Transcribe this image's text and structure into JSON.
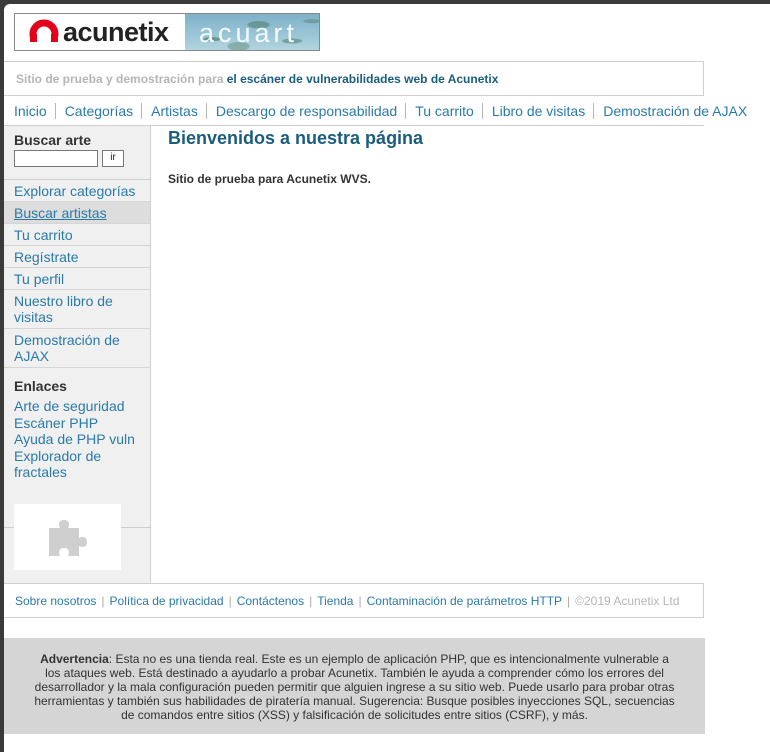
{
  "logo": {
    "brand": "acunetix",
    "product": "acuart"
  },
  "tagline": {
    "muted": "Sitio de prueba y demostración para",
    "strong": "el escáner de vulnerabilidades web de Acunetix"
  },
  "topnav": [
    "Inicio",
    "Categorías",
    "Artistas",
    "Descargo de responsabilidad",
    "Tu carrito",
    "Libro de visitas",
    "Demostración de AJAX"
  ],
  "sidebar": {
    "search_title": "Buscar arte",
    "search_value": "",
    "search_button": "ir",
    "items": [
      "Explorar categorías",
      "Buscar artistas",
      "Tu carrito",
      "Regístrate",
      "Tu perfil",
      "Nuestro libro de visitas",
      "Demostración de AJAX"
    ],
    "links_title": "Enlaces",
    "links": [
      "Arte de seguridad",
      "Escáner PHP",
      "Ayuda de PHP vuln",
      "Explorador de fractales"
    ],
    "plugin_icon": "puzzle-icon"
  },
  "main": {
    "title": "Bienvenidos a nuestra página",
    "text": "Sitio de prueba para Acunetix WVS."
  },
  "footer": {
    "links": [
      "Sobre nosotros",
      "Política de privacidad",
      "Contáctenos",
      "Tienda",
      "Contaminación de parámetros HTTP"
    ],
    "copyright": "©2019 Acunetix Ltd"
  },
  "warning": {
    "label": "Advertencia",
    "text": ": Esta no es una tienda real. Este es un ejemplo de aplicación PHP, que es intencionalmente vulnerable a los ataques web. Está destinado a ayudarlo a probar Acunetix. También le ayuda a comprender cómo los errores del desarrollador y la mala configuración pueden permitir que alguien ingrese a su sitio web. Puede usarlo para probar otras herramientas y también sus habilidades de piratería manual. Sugerencia: Busque posibles inyecciones SQL, secuencias de comandos entre sitios (XSS) y falsificación de solicitudes entre sitios (CSRF), y más."
  },
  "colors": {
    "link": "#2a7aa8",
    "heading": "#1a5d7e",
    "sidebar_bg": "#f0f0f0",
    "warning_bg": "#d5d5d5",
    "logo_red": "#e3001b"
  }
}
